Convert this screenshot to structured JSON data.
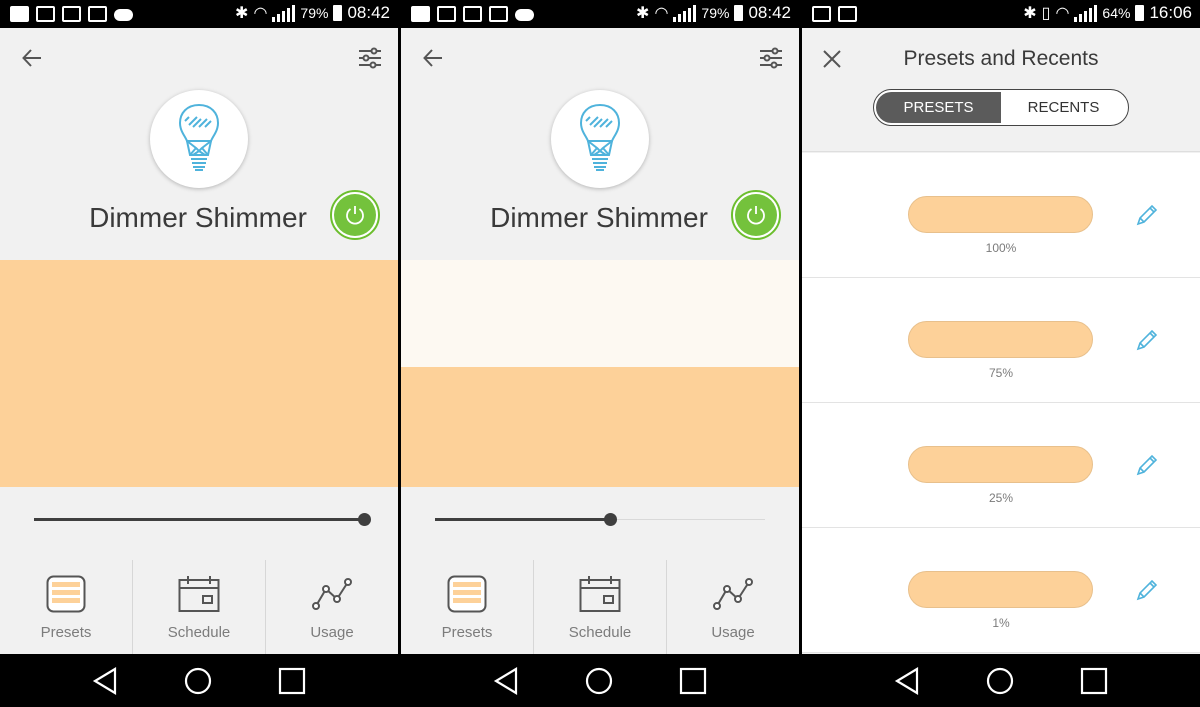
{
  "status_bars": [
    {
      "battery_pct": "79%",
      "time": "08:42"
    },
    {
      "battery_pct": "79%",
      "time": "08:42"
    },
    {
      "battery_pct": "64%",
      "time": "16:06"
    }
  ],
  "device": {
    "name": "Dimmer Shimmer",
    "power_state": "on",
    "brightness_screen1": 1.0,
    "brightness_screen2": 0.53
  },
  "tabs": [
    {
      "label": "Presets",
      "icon": "presets-icon"
    },
    {
      "label": "Schedule",
      "icon": "calendar-icon"
    },
    {
      "label": "Usage",
      "icon": "usage-chart-icon"
    }
  ],
  "presets_screen": {
    "title": "Presets and Recents",
    "segments": [
      {
        "label": "PRESETS",
        "active": true
      },
      {
        "label": "RECENTS",
        "active": false
      }
    ],
    "presets": [
      {
        "value": "100%"
      },
      {
        "value": "75%"
      },
      {
        "value": "25%"
      },
      {
        "value": "1%"
      }
    ]
  },
  "colors": {
    "warm_light": "#fdd199",
    "power_green": "#74c23c",
    "accent_blue": "#4fb3dc"
  }
}
